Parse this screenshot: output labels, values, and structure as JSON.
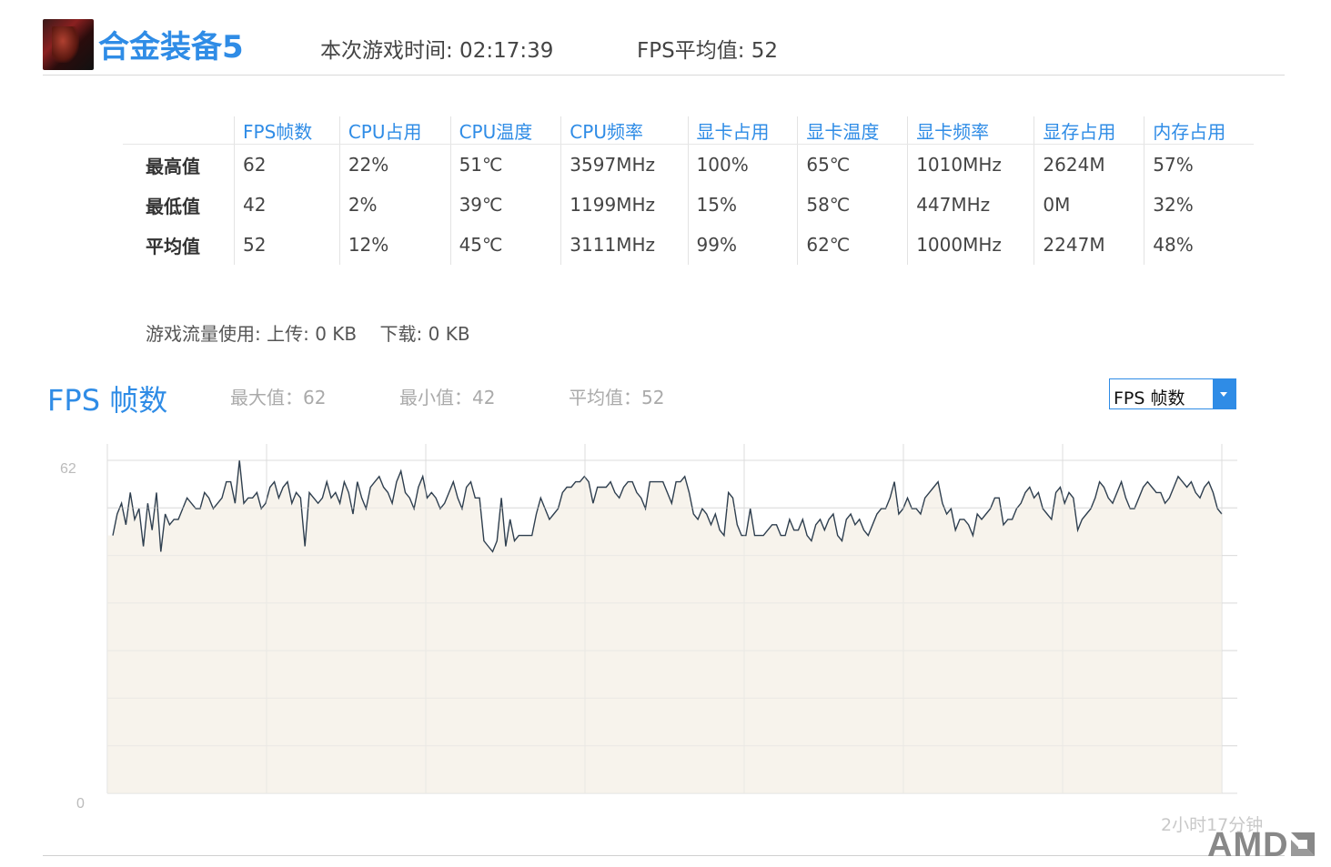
{
  "header": {
    "game_title": "合金装备5",
    "play_time": "本次游戏时间: 02:17:39",
    "fps_avg": "FPS平均值: 52"
  },
  "stats": {
    "columns": [
      "FPS帧数",
      "CPU占用",
      "CPU温度",
      "CPU频率",
      "显卡占用",
      "显卡温度",
      "显卡频率",
      "显存占用",
      "内存占用"
    ],
    "rows": [
      {
        "label": "最高值",
        "values": [
          "62",
          "22%",
          "51℃",
          "3597MHz",
          "100%",
          "65℃",
          "1010MHz",
          "2624M",
          "57%"
        ]
      },
      {
        "label": "最低值",
        "values": [
          "42",
          "2%",
          "39℃",
          "1199MHz",
          "15%",
          "58℃",
          "447MHz",
          "0M",
          "32%"
        ]
      },
      {
        "label": "平均值",
        "values": [
          "52",
          "12%",
          "45℃",
          "3111MHz",
          "99%",
          "62℃",
          "1000MHz",
          "2247M",
          "48%"
        ]
      }
    ]
  },
  "traffic": "游戏流量使用: 上传: 0 KB    下载: 0 KB",
  "chart_section": {
    "title": "FPS 帧数",
    "max": "最大值：62",
    "min": "最小值：42",
    "avg": "平均值：52",
    "selected_metric": "FPS 帧数",
    "duration": "2小时17分钟"
  },
  "brand": {
    "logo_text": "AMD"
  },
  "colors": {
    "accent": "#2f8ce6",
    "line": "#2f3f4f",
    "fill": "#f7f3ec",
    "grid": "#dcdcdc"
  },
  "chart_data": {
    "type": "area",
    "ylim": [
      0,
      62
    ],
    "y_tick_labels": [
      "62",
      "0"
    ],
    "x_end_label": "2小时17分钟",
    "grid": true,
    "values": [
      48,
      52,
      54,
      50,
      56,
      51,
      53,
      46,
      54,
      49,
      56,
      45,
      52,
      50,
      51,
      51,
      53,
      55,
      54,
      53,
      53,
      56,
      55,
      53,
      54,
      55,
      58,
      58,
      54,
      62,
      54,
      55,
      55,
      56,
      53,
      54,
      57,
      58,
      55,
      57,
      58,
      54,
      56,
      55,
      46,
      56,
      55,
      54,
      55,
      58,
      55,
      56,
      54,
      58,
      56,
      52,
      58,
      55,
      53,
      57,
      58,
      59,
      57,
      56,
      54,
      58,
      60,
      56,
      55,
      53,
      57,
      59,
      55,
      56,
      55,
      53,
      54,
      56,
      58,
      55,
      53,
      57,
      58,
      55,
      55,
      47,
      46,
      45,
      47,
      55,
      46,
      51,
      47,
      48,
      48,
      48,
      48,
      52,
      55,
      53,
      51,
      52,
      53,
      56,
      57,
      57,
      58,
      58,
      59,
      58,
      54,
      57,
      57,
      57,
      58,
      56,
      55,
      57,
      58,
      58,
      56,
      55,
      53,
      58,
      58,
      58,
      58,
      56,
      54,
      58,
      58,
      59,
      56,
      52,
      51,
      53,
      52,
      50,
      52,
      49,
      48,
      56,
      55,
      50,
      48,
      48,
      53,
      48,
      48,
      48,
      49,
      50,
      50,
      48,
      48,
      51,
      49,
      49,
      51,
      48,
      47,
      50,
      51,
      49,
      51,
      52,
      48,
      47,
      51,
      52,
      50,
      51,
      49,
      48,
      50,
      52,
      53,
      53,
      55,
      58,
      52,
      53,
      55,
      53,
      53,
      52,
      55,
      56,
      57,
      58,
      54,
      52,
      53,
      49,
      51,
      51,
      50,
      48,
      52,
      51,
      52,
      53,
      55,
      55,
      50,
      51,
      51,
      53,
      54,
      56,
      57,
      55,
      56,
      53,
      52,
      51,
      56,
      57,
      54,
      56,
      55,
      49,
      51,
      52,
      53,
      55,
      58,
      57,
      55,
      54,
      56,
      58,
      55,
      53,
      53,
      55,
      57,
      58,
      57,
      56,
      56,
      54,
      55,
      57,
      59,
      58,
      57,
      58,
      56,
      55,
      57,
      58,
      56,
      53,
      52
    ]
  }
}
